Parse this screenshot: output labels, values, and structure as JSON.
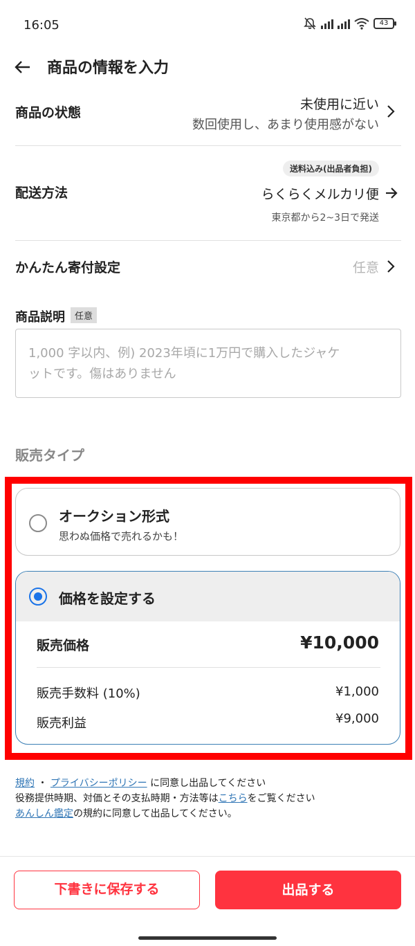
{
  "status_bar": {
    "time": "16:05",
    "battery": "43"
  },
  "header": {
    "title": "商品の情報を入力"
  },
  "condition": {
    "label": "商品の状態",
    "value": "未使用に近い",
    "description": "数回使用し、あまり使用感がない"
  },
  "shipping": {
    "label": "配送方法",
    "badge": "送料込み(出品者負担)",
    "method": "らくらくメルカリ便",
    "note": "東京都から2~3日で発送"
  },
  "donation": {
    "label": "かんたん寄付設定",
    "value": "任意"
  },
  "description": {
    "label": "商品説明",
    "tag": "任意",
    "placeholder_line1": "1,000 字以内、例) 2023年頃に1万円で購入したジャケ",
    "placeholder_line2": "ットです。傷はありません"
  },
  "sale_type": {
    "title": "販売タイプ",
    "auction": {
      "title": "オークション形式",
      "subtitle": "思わぬ価格で売れるかも！",
      "selected": false
    },
    "fixed": {
      "title": "価格を設定する",
      "selected": true,
      "price_label": "販売価格",
      "price_value": "¥10,000",
      "fee_label": "販売手数料 (10%)",
      "fee_value": "¥1,000",
      "profit_label": "販売利益",
      "profit_value": "¥9,000"
    }
  },
  "terms": {
    "link_rules": "規約",
    "separator": "・",
    "link_privacy": "プライバシーポリシー",
    "line1_rest": "に同意し出品してください",
    "line2_start": "役務提供時期、対価とその支払時期・方法等は",
    "link_here": "こちら",
    "line2_end": "をご覧ください",
    "link_anshin": "あんしん鑑定",
    "line3_end": "の規約に同意して出品してください。"
  },
  "buttons": {
    "draft": "下書きに保存する",
    "list": "出品する"
  },
  "colors": {
    "accent": "#ff333f",
    "link": "#2f75b5",
    "radio_selected": "#1a73e8",
    "highlight": "#ff0000"
  }
}
